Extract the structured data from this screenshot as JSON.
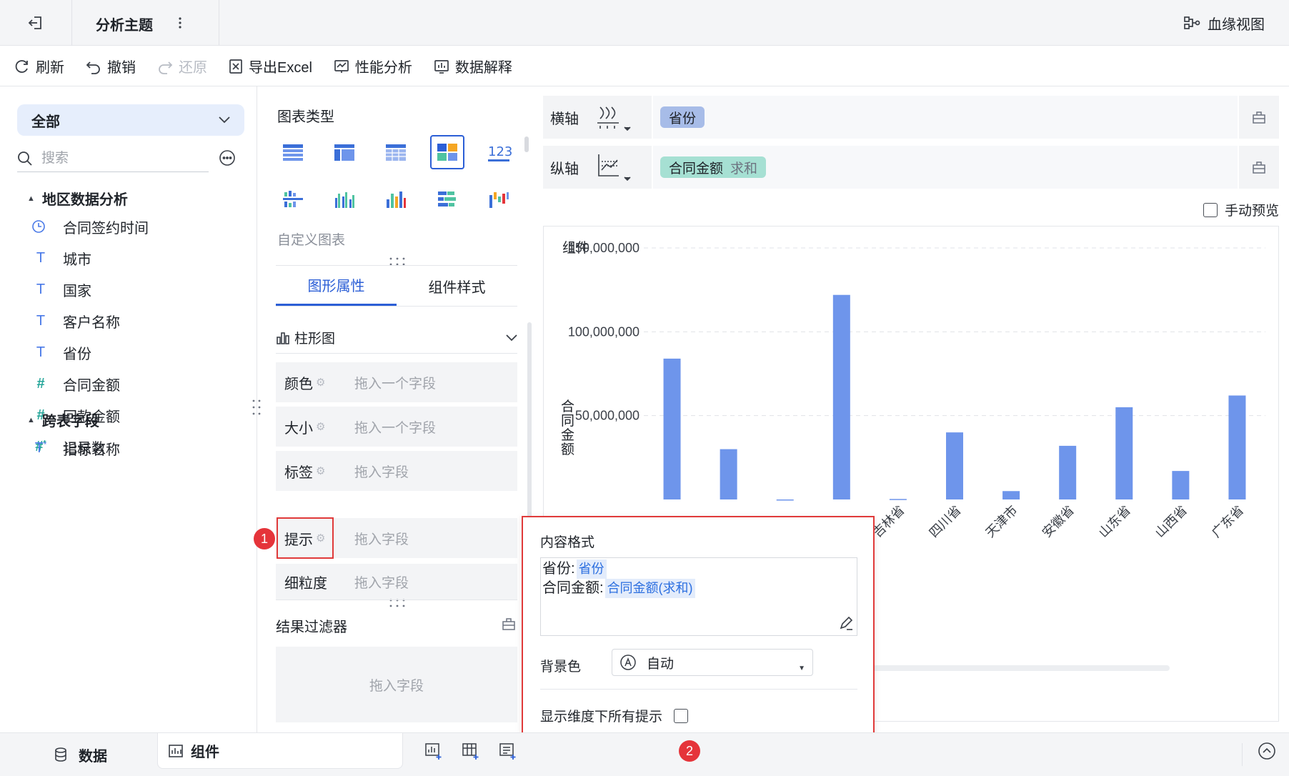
{
  "topbar": {
    "tab_title": "分析主题",
    "lineage_label": "血缘视图"
  },
  "toolbar": {
    "refresh": "刷新",
    "undo": "撤销",
    "redo": "还原",
    "export_excel": "导出Excel",
    "performance": "性能分析",
    "data_explain": "数据解释"
  },
  "left": {
    "scope": "全部",
    "search_placeholder": "搜索",
    "groups": [
      {
        "name": "地区数据分析",
        "fields": [
          {
            "icon": "clock",
            "label": "合同签约时间"
          },
          {
            "icon": "T",
            "label": "城市"
          },
          {
            "icon": "T",
            "label": "国家"
          },
          {
            "icon": "T",
            "label": "客户名称"
          },
          {
            "icon": "T",
            "label": "省份"
          },
          {
            "icon": "#",
            "label": "合同金额"
          },
          {
            "icon": "#",
            "label": "回款金额"
          },
          {
            "icon": "#*",
            "label": "记录数"
          }
        ]
      },
      {
        "name": "跨表字段",
        "fields": [
          {
            "icon": "T*",
            "label": "指标名称"
          }
        ]
      }
    ]
  },
  "middle": {
    "chart_type_label": "图表类型",
    "custom_chart": "自定义图表",
    "tabs": [
      "图形属性",
      "组件样式"
    ],
    "chart_subtype": "柱形图",
    "props": [
      {
        "label": "颜色",
        "drop": "拖入一个字段"
      },
      {
        "label": "大小",
        "drop": "拖入一个字段"
      },
      {
        "label": "标签",
        "drop": "拖入字段"
      },
      {
        "label": "提示",
        "drop": "拖入字段"
      },
      {
        "label": "细粒度",
        "drop": "拖入字段"
      }
    ],
    "badge1": "1",
    "filter_title": "结果过滤器",
    "filter_drop": "拖入字段"
  },
  "right": {
    "x_axis_label": "横轴",
    "y_axis_label": "纵轴",
    "x_field": "省份",
    "y_field": "合同金额",
    "y_agg": "求和",
    "manual_preview": "手动预览"
  },
  "popup": {
    "title": "内容格式",
    "line1_label": "省份:",
    "line1_token": "省份",
    "line2_label": "合同金额:",
    "line2_token": "合同金额(求和)",
    "bg_label": "背景色",
    "bg_value": "自动",
    "show_all": "显示维度下所有提示",
    "badge2": "2"
  },
  "bottom": {
    "data_tab": "数据",
    "component_tab": "组件"
  },
  "colors": {
    "accent": "#2c5fd6",
    "bar": "#6e95eb",
    "highlight": "#e03a3a"
  },
  "chart_data": {
    "type": "bar",
    "title": "组件",
    "xlabel": "",
    "ylabel": "合同金额",
    "ylim": [
      0,
      150000000
    ],
    "y_ticks": [
      50000000,
      100000000,
      150000000
    ],
    "y_tick_labels": [
      "50,000,000",
      "100,000,000",
      "150,000,000"
    ],
    "grid": true,
    "categories": [
      "",
      "",
      "",
      "",
      "吉林省",
      "四川省",
      "天津市",
      "安徽省",
      "山东省",
      "山西省",
      "广东省"
    ],
    "values": [
      84000000,
      30000000,
      0,
      122000000,
      300000,
      40000000,
      5000000,
      32000000,
      55000000,
      17000000,
      62000000
    ]
  }
}
